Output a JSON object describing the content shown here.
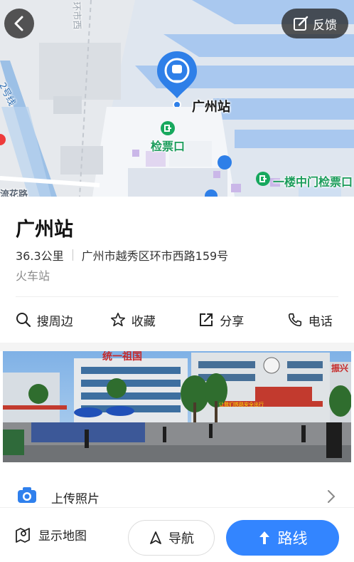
{
  "map": {
    "back_icon": "chevron-left-icon",
    "feedback_icon": "edit-icon",
    "feedback_label": "反馈",
    "station_pin_label": "广州站",
    "ticket_gate_label": "检票口",
    "gate_1f_label": "一楼中门检票口",
    "line2_label": "2号线",
    "faded_label_top": "环市西",
    "faded_label_bottom": "流花路"
  },
  "place": {
    "name": "广州站",
    "distance": "36.3公里",
    "address": "广州市越秀区环市西路159号",
    "category": "火车站"
  },
  "actions": [
    {
      "label": "搜周边",
      "icon": "search-icon"
    },
    {
      "label": "收藏",
      "icon": "star-icon"
    },
    {
      "label": "分享",
      "icon": "share-icon"
    },
    {
      "label": "电话",
      "icon": "phone-icon"
    }
  ],
  "photo": {
    "banner_text": "统一祖国",
    "banner_text_right": "振兴",
    "banner_sub": "让我们铁路安全出行"
  },
  "upload": {
    "label": "上传照片",
    "icon": "camera-icon"
  },
  "bottom_bar": {
    "show_map_label": "显示地图",
    "navigate_label": "导航",
    "route_label": "路线"
  },
  "colors": {
    "accent": "#3385ff",
    "gate_green": "#17a85e"
  }
}
